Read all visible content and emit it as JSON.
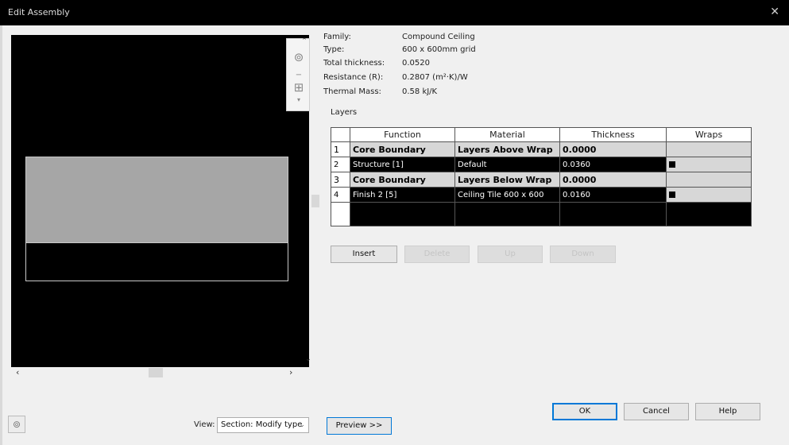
{
  "window": {
    "title": "Edit Assembly",
    "close_glyph": "✕"
  },
  "properties": [
    {
      "key": "Family:",
      "value": "Compound Ceiling"
    },
    {
      "key": "Type:",
      "value": "600 x 600mm grid"
    },
    {
      "key": "Total thickness:",
      "value": "0.0520"
    },
    {
      "key": "Resistance (R):",
      "value": "0.2807 (m²·K)/W"
    },
    {
      "key": "Thermal Mass:",
      "value": "0.58 kJ/K"
    }
  ],
  "layers": {
    "label": "Layers",
    "headers": [
      "Function",
      "Material",
      "Thickness",
      "Wraps"
    ],
    "rows": [
      {
        "num": "1",
        "function": "Core Boundary",
        "material": "Layers Above Wrap",
        "thickness": "0.0000"
      },
      {
        "num": "2",
        "function": "Structure [1]",
        "material": "Default",
        "thickness": "0.0360"
      },
      {
        "num": "3",
        "function": "Core Boundary",
        "material": "Layers Below Wrap",
        "thickness": "0.0000"
      },
      {
        "num": "4",
        "function": "Finish 2 [5]",
        "material": "Ceiling Tile 600 x 600",
        "thickness": "0.0160"
      }
    ]
  },
  "buttons": {
    "insert": "Insert",
    "delete": "Delete",
    "up": "Up",
    "down": "Down",
    "ok": "OK",
    "cancel": "Cancel",
    "help": "Help",
    "preview": "Preview >>"
  },
  "view": {
    "label": "View:",
    "selected": "Section: Modify type"
  },
  "icons": {
    "zoom": "zoom-icon",
    "pan": "pan-icon",
    "corner": "view-cube-icon"
  }
}
